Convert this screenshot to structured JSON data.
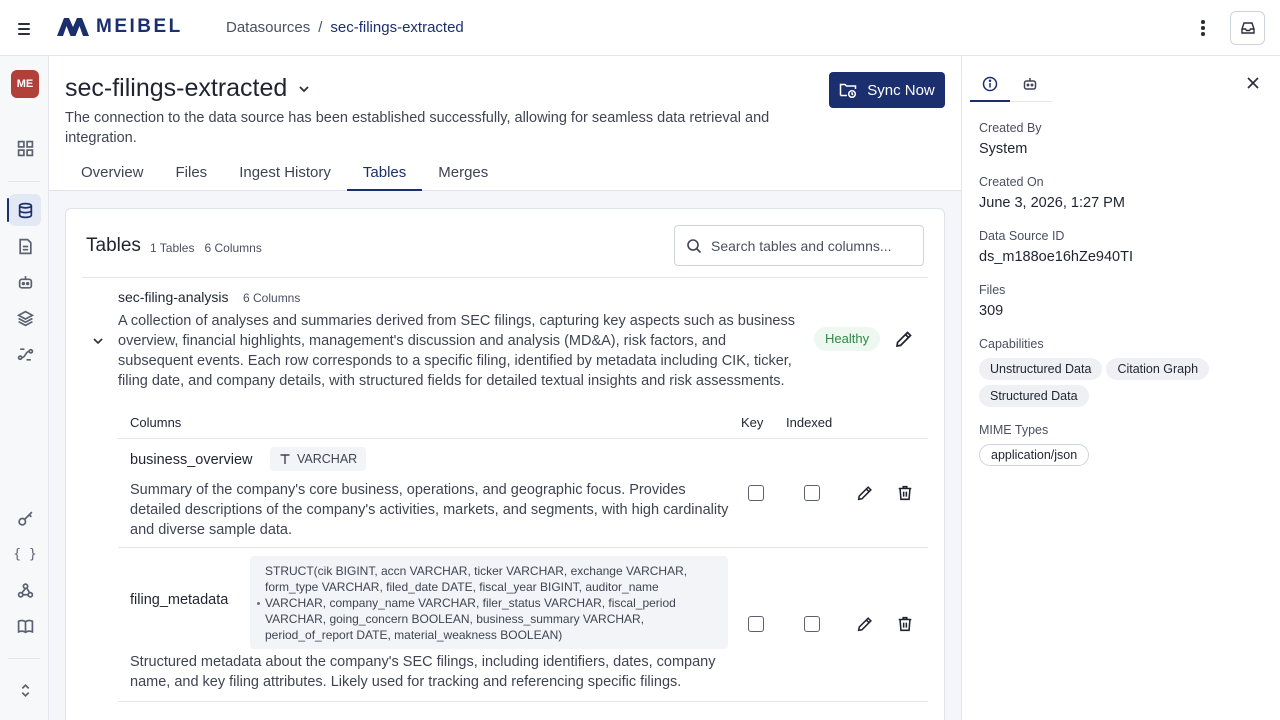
{
  "app": {
    "logo_text": "MEIBEL",
    "brand_color": "#1b2f6e"
  },
  "breadcrumb": {
    "root": "Datasources",
    "separator": "/",
    "current": "sec-filings-extracted"
  },
  "user": {
    "initials": "ME"
  },
  "page": {
    "title": "sec-filings-extracted",
    "subtitle": "The connection to the data source has been established successfully, allowing for seamless data retrieval and integration.",
    "sync_label": "Sync Now",
    "tabs": [
      "Overview",
      "Files",
      "Ingest History",
      "Tables",
      "Merges"
    ],
    "active_tab": "Tables"
  },
  "tables_card": {
    "title": "Tables",
    "table_count": "1 Tables",
    "column_count": "6 Columns",
    "search_placeholder": "Search tables and columns...",
    "table": {
      "name": "sec-filing-analysis",
      "columns_count": "6 Columns",
      "description": "A collection of analyses and summaries derived from SEC filings, capturing key aspects such as business overview, financial highlights, management's discussion and analysis (MD&A), risk factors, and subsequent events. Each row corresponds to a specific filing, identified by metadata including CIK, ticker, filing date, and company details, with structured fields for detailed textual insights and risk assessments.",
      "status": "Healthy"
    },
    "column_headers": {
      "columns": "Columns",
      "key": "Key",
      "indexed": "Indexed"
    },
    "columns": [
      {
        "name": "business_overview",
        "type": "VARCHAR",
        "description": "Summary of the company's core business, operations, and geographic focus. Provides detailed descriptions of the company's activities, markets, and segments, with high cardinality and diverse sample data.",
        "key": false,
        "indexed": false
      },
      {
        "name": "filing_metadata",
        "type": "STRUCT(cik BIGINT, accn VARCHAR, ticker VARCHAR, exchange VARCHAR, form_type VARCHAR, filed_date DATE, fiscal_year BIGINT, auditor_name VARCHAR, company_name VARCHAR, filer_status VARCHAR, fiscal_period VARCHAR, going_concern BOOLEAN, business_summary VARCHAR, period_of_report DATE, material_weakness BOOLEAN)",
        "description": "Structured metadata about the company's SEC filings, including identifiers, dates, company name, and key filing attributes. Likely used for tracking and referencing specific filings.",
        "key": false,
        "indexed": false
      }
    ]
  },
  "details_panel": {
    "created_by_label": "Created By",
    "created_by": "System",
    "created_on_label": "Created On",
    "created_on": "June 3, 2026, 1:27 PM",
    "source_id_label": "Data Source ID",
    "source_id": "ds_m188oe16hZe940TI",
    "files_label": "Files",
    "files": "309",
    "capabilities_label": "Capabilities",
    "capabilities": [
      "Unstructured Data",
      "Citation Graph",
      "Structured Data"
    ],
    "mime_label": "MIME Types",
    "mime_types": [
      "application/json"
    ]
  },
  "colors": {
    "status_healthy": "#2f8a47",
    "avatar": "#b13f3a",
    "accent": "#1b2f6e"
  }
}
